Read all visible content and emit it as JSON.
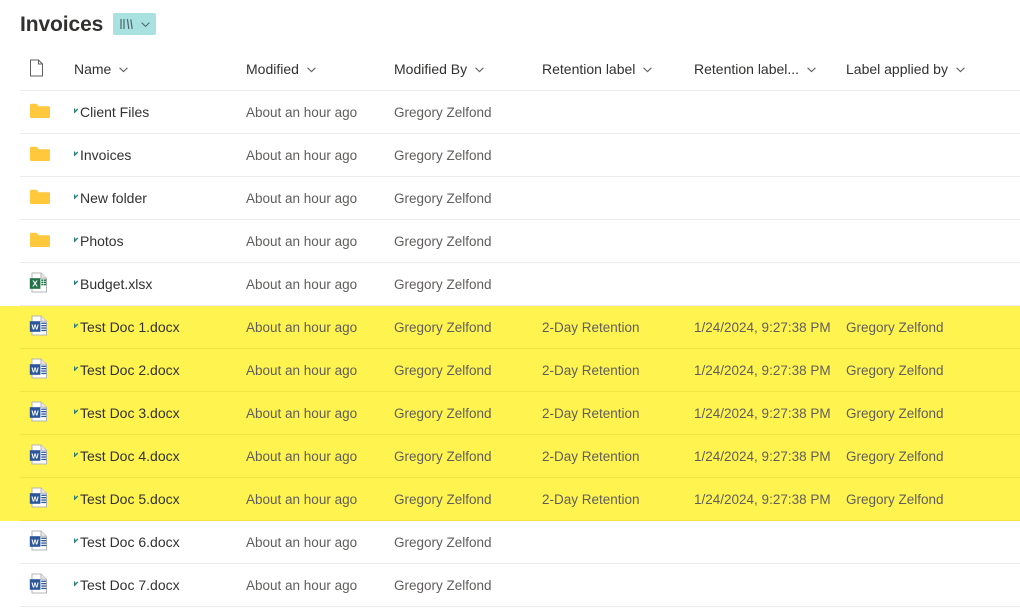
{
  "header": {
    "title": "Invoices",
    "view_switcher": {
      "icon": "list-view-icon",
      "chevron": "chevron-down-icon",
      "highlight_color": "#a9e0e0"
    }
  },
  "table": {
    "columns": [
      {
        "key": "file_type",
        "label": "",
        "icon": "document-icon",
        "has_chevron": false
      },
      {
        "key": "name",
        "label": "Name",
        "has_chevron": true
      },
      {
        "key": "modified",
        "label": "Modified",
        "has_chevron": true
      },
      {
        "key": "modified_by",
        "label": "Modified By",
        "has_chevron": true
      },
      {
        "key": "retention_label",
        "label": "Retention label",
        "has_chevron": true
      },
      {
        "key": "retention_label_applied",
        "label": "Retention label...",
        "has_chevron": true
      },
      {
        "key": "label_applied_by",
        "label": "Label applied by",
        "has_chevron": true
      }
    ],
    "rows": [
      {
        "icon": "folder-icon",
        "is_new": true,
        "name": "Client Files",
        "modified": "About an hour ago",
        "modified_by": "Gregory Zelfond",
        "retention_label": "",
        "retention_label_applied": "",
        "label_applied_by": "",
        "highlighted": false
      },
      {
        "icon": "folder-icon",
        "is_new": true,
        "name": "Invoices",
        "modified": "About an hour ago",
        "modified_by": "Gregory Zelfond",
        "retention_label": "",
        "retention_label_applied": "",
        "label_applied_by": "",
        "highlighted": false
      },
      {
        "icon": "folder-icon",
        "is_new": true,
        "name": "New folder",
        "modified": "About an hour ago",
        "modified_by": "Gregory Zelfond",
        "retention_label": "",
        "retention_label_applied": "",
        "label_applied_by": "",
        "highlighted": false
      },
      {
        "icon": "folder-icon",
        "is_new": true,
        "name": "Photos",
        "modified": "About an hour ago",
        "modified_by": "Gregory Zelfond",
        "retention_label": "",
        "retention_label_applied": "",
        "label_applied_by": "",
        "highlighted": false
      },
      {
        "icon": "excel-file-icon",
        "is_new": true,
        "name": "Budget.xlsx",
        "modified": "About an hour ago",
        "modified_by": "Gregory Zelfond",
        "retention_label": "",
        "retention_label_applied": "",
        "label_applied_by": "",
        "highlighted": false
      },
      {
        "icon": "word-file-icon",
        "is_new": true,
        "name": "Test Doc 1.docx",
        "modified": "About an hour ago",
        "modified_by": "Gregory Zelfond",
        "retention_label": "2-Day Retention",
        "retention_label_applied": "1/24/2024, 9:27:38 PM",
        "label_applied_by": "Gregory Zelfond",
        "highlighted": true
      },
      {
        "icon": "word-file-icon",
        "is_new": true,
        "name": "Test Doc 2.docx",
        "modified": "About an hour ago",
        "modified_by": "Gregory Zelfond",
        "retention_label": "2-Day Retention",
        "retention_label_applied": "1/24/2024, 9:27:38 PM",
        "label_applied_by": "Gregory Zelfond",
        "highlighted": true
      },
      {
        "icon": "word-file-icon",
        "is_new": true,
        "name": "Test Doc 3.docx",
        "modified": "About an hour ago",
        "modified_by": "Gregory Zelfond",
        "retention_label": "2-Day Retention",
        "retention_label_applied": "1/24/2024, 9:27:38 PM",
        "label_applied_by": "Gregory Zelfond",
        "highlighted": true
      },
      {
        "icon": "word-file-icon",
        "is_new": true,
        "name": "Test Doc 4.docx",
        "modified": "About an hour ago",
        "modified_by": "Gregory Zelfond",
        "retention_label": "2-Day Retention",
        "retention_label_applied": "1/24/2024, 9:27:38 PM",
        "label_applied_by": "Gregory Zelfond",
        "highlighted": true
      },
      {
        "icon": "word-file-icon",
        "is_new": true,
        "name": "Test Doc 5.docx",
        "modified": "About an hour ago",
        "modified_by": "Gregory Zelfond",
        "retention_label": "2-Day Retention",
        "retention_label_applied": "1/24/2024, 9:27:38 PM",
        "label_applied_by": "Gregory Zelfond",
        "highlighted": true
      },
      {
        "icon": "word-file-icon",
        "is_new": true,
        "name": "Test Doc 6.docx",
        "modified": "About an hour ago",
        "modified_by": "Gregory Zelfond",
        "retention_label": "",
        "retention_label_applied": "",
        "label_applied_by": "",
        "highlighted": false
      },
      {
        "icon": "word-file-icon",
        "is_new": true,
        "name": "Test Doc 7.docx",
        "modified": "About an hour ago",
        "modified_by": "Gregory Zelfond",
        "retention_label": "",
        "retention_label_applied": "",
        "label_applied_by": "",
        "highlighted": false
      }
    ]
  },
  "colors": {
    "highlight_yellow": "#fff44f",
    "folder_yellow": "#ffc83d",
    "word_blue": "#2b579a",
    "excel_green": "#217346",
    "new_badge_teal": "#2e7d7d",
    "text_primary": "#323130",
    "text_secondary": "#605e5c",
    "divider": "#edebe9"
  }
}
